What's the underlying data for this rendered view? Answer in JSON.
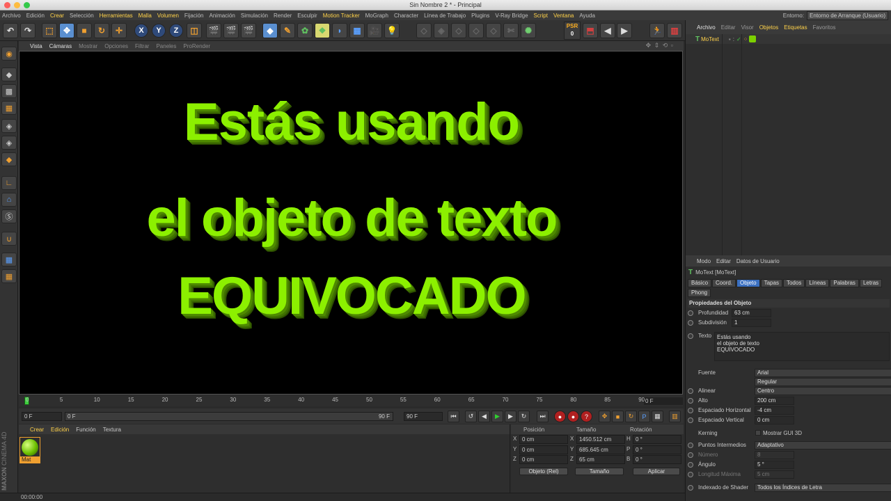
{
  "window": {
    "title": "Sin Nombre 2 * - Principal"
  },
  "menubar": {
    "items": [
      {
        "label": "Archivo",
        "y": false
      },
      {
        "label": "Edición",
        "y": false
      },
      {
        "label": "Crear",
        "y": true
      },
      {
        "label": "Selección",
        "y": false
      },
      {
        "label": "Herramientas",
        "y": true
      },
      {
        "label": "Malla",
        "y": true
      },
      {
        "label": "Volumen",
        "y": true
      },
      {
        "label": "Fijación",
        "y": false
      },
      {
        "label": "Animación",
        "y": false
      },
      {
        "label": "Simulación",
        "y": false
      },
      {
        "label": "Render",
        "y": false
      },
      {
        "label": "Esculpir",
        "y": false
      },
      {
        "label": "Motion Tracker",
        "y": true
      },
      {
        "label": "MoGraph",
        "y": false
      },
      {
        "label": "Character",
        "y": false
      },
      {
        "label": "Línea de Trabajo",
        "y": false
      },
      {
        "label": "Plugins",
        "y": false
      },
      {
        "label": "V-Ray Bridge",
        "y": false
      },
      {
        "label": "Script",
        "y": true
      },
      {
        "label": "Ventana",
        "y": true
      },
      {
        "label": "Ayuda",
        "y": false
      }
    ],
    "env_label": "Entorno:",
    "env_value": "Entorno de Arranque (Usuario)"
  },
  "toolbar": {
    "x": "X",
    "y": "Y",
    "z": "Z",
    "psr_label": "PSR",
    "psr_value": "0"
  },
  "viewport": {
    "menu": [
      {
        "label": "Vista",
        "w": true
      },
      {
        "label": "Cámaras",
        "w": true
      },
      {
        "label": "Mostrar",
        "w": false
      },
      {
        "label": "Opciones",
        "w": false
      },
      {
        "label": "Filtrar",
        "w": false
      },
      {
        "label": "Paneles",
        "w": false
      },
      {
        "label": "ProRender",
        "w": false
      }
    ],
    "lines": [
      "Estás usando",
      "el objeto de texto",
      "EQUIVOCADO"
    ],
    "text_color": "#8cf000"
  },
  "timeline": {
    "ticks": [
      "0",
      "5",
      "10",
      "15",
      "20",
      "25",
      "30",
      "35",
      "40",
      "45",
      "50",
      "55",
      "60",
      "65",
      "70",
      "75",
      "80",
      "85",
      "90"
    ],
    "frame_right": "0 F",
    "start": "0 F",
    "range_start": "0 F",
    "range_end": "90 F",
    "end": "90 F"
  },
  "materials": {
    "menu": [
      "Crear",
      "Edición",
      "Función",
      "Textura"
    ],
    "mat_name": "Mat"
  },
  "coords": {
    "headers": [
      "Posición",
      "Tamaño",
      "Rotación"
    ],
    "rows": [
      {
        "axis": "X",
        "pos": "0 cm",
        "size_axis": "X",
        "size": "1450.512 cm",
        "rot_axis": "H",
        "rot": "0 °"
      },
      {
        "axis": "Y",
        "pos": "0 cm",
        "size_axis": "Y",
        "size": "685.645 cm",
        "rot_axis": "P",
        "rot": "0 °"
      },
      {
        "axis": "Z",
        "pos": "0 cm",
        "size_axis": "Z",
        "size": "65 cm",
        "rot_axis": "B",
        "rot": "0 °"
      }
    ],
    "mode": "Objeto (Rel)",
    "size_mode": "Tamaño",
    "apply": "Aplicar"
  },
  "status": {
    "time": "00:00:00"
  },
  "brand": {
    "maxon": "MAXON",
    "product": "CINEMA 4D"
  },
  "objects": {
    "menu": [
      {
        "label": "Archivo",
        "c": "w"
      },
      {
        "label": "Editar",
        "c": "g"
      },
      {
        "label": "Visor",
        "c": "g"
      },
      {
        "label": "Objetos",
        "c": "y"
      },
      {
        "label": "Etiquetas",
        "c": "y"
      },
      {
        "label": "Favoritos",
        "c": "g"
      }
    ],
    "item": "MoText"
  },
  "attributes": {
    "menu": [
      "Modo",
      "Editar",
      "Datos de Usuario"
    ],
    "object_title": "MoText [MoText]",
    "tabs": [
      {
        "label": "Básico",
        "sel": false
      },
      {
        "label": "Coord.",
        "sel": false
      },
      {
        "label": "Objeto",
        "sel": true
      },
      {
        "label": "Tapas",
        "sel": false
      },
      {
        "label": "Todos",
        "sel": false
      },
      {
        "label": "Líneas",
        "sel": false
      },
      {
        "label": "Palabras",
        "sel": false
      },
      {
        "label": "Letras",
        "sel": false
      },
      {
        "label": "Phong",
        "sel": false
      }
    ],
    "section": "Propiedades del Objeto",
    "depth_label": "Profundidad",
    "depth": "63 cm",
    "subdiv_label": "Subdivisión",
    "subdiv": "1",
    "text_label": "Texto",
    "text_lines": [
      "Estás usando",
      "el objeto de texto",
      "EQUIVOCADO"
    ],
    "font_label": "Fuente",
    "font": "Arial",
    "font_style": "Regular",
    "align_label": "Alinear",
    "align": "Centro",
    "height_label": "Alto",
    "height": "200 cm",
    "hspace_label": "Espaciado Horizontal",
    "hspace": "-4 cm",
    "vspace_label": "Espaciado Vertical",
    "vspace": "0 cm",
    "kerning_label": "Kerning",
    "gui3d_label": "Mostrar GUI 3D",
    "interp_label": "Puntos Intermedios",
    "interp": "Adaptativo",
    "number_label": "Número",
    "number": "8",
    "angle_label": "Ángulo",
    "angle": "5 °",
    "maxlen_label": "Longitud Máxima",
    "maxlen": "5 cm",
    "shader_label": "Indexado de Shader",
    "shader": "Todos los Índices de Letra"
  }
}
